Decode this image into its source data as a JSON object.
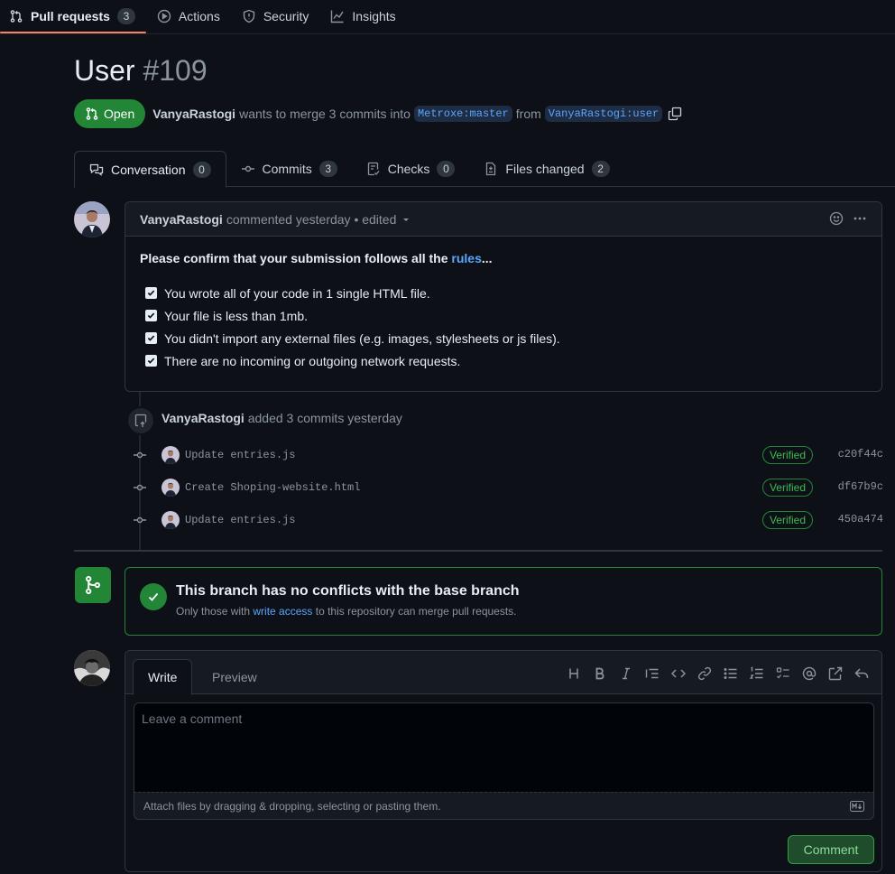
{
  "nav": {
    "items": [
      {
        "label": "Pull requests",
        "count": "3"
      },
      {
        "label": "Actions"
      },
      {
        "label": "Security"
      },
      {
        "label": "Insights"
      }
    ]
  },
  "pr": {
    "title": "User",
    "number": "#109",
    "state": "Open",
    "author": "VanyaRastogi",
    "summary_text": "wants to merge 3 commits into",
    "base_ref": "Metroxe:master",
    "from_text": "from",
    "head_ref": "VanyaRastogi:user"
  },
  "tabs": [
    {
      "label": "Conversation",
      "count": "0"
    },
    {
      "label": "Commits",
      "count": "3"
    },
    {
      "label": "Checks",
      "count": "0"
    },
    {
      "label": "Files changed",
      "count": "2"
    }
  ],
  "comment": {
    "author": "VanyaRastogi",
    "meta": "commented yesterday • edited",
    "confirm_prefix": "Please confirm that your submission follows all the ",
    "confirm_link": "rules",
    "confirm_suffix": "...",
    "tasks": [
      "You wrote all of your code in 1 single HTML file.",
      "Your file is less than 1mb.",
      "You didn't import any external files (e.g. images, stylesheets or js files).",
      "There are no incoming or outgoing network requests."
    ]
  },
  "timeline": {
    "push_author": "VanyaRastogi",
    "push_text": "added 3 commits yesterday",
    "commits": [
      {
        "message": "Update entries.js",
        "badge": "Verified",
        "sha": "c20f44c"
      },
      {
        "message": "Create Shoping-website.html",
        "badge": "Verified",
        "sha": "df67b9c"
      },
      {
        "message": "Update entries.js",
        "badge": "Verified",
        "sha": "450a474"
      }
    ]
  },
  "merge": {
    "title": "This branch has no conflicts with the base branch",
    "sub_prefix": "Only those with ",
    "sub_link": "write access",
    "sub_suffix": " to this repository can merge pull requests."
  },
  "new_comment": {
    "tab_write": "Write",
    "tab_preview": "Preview",
    "placeholder": "Leave a comment",
    "attach_text": "Attach files by dragging & dropping, selecting or pasting them.",
    "submit_label": "Comment"
  },
  "colors": {
    "background": "#0d1117",
    "accent_green": "#238636",
    "link_blue": "#58a6ff",
    "nav_underline": "#f78166"
  }
}
